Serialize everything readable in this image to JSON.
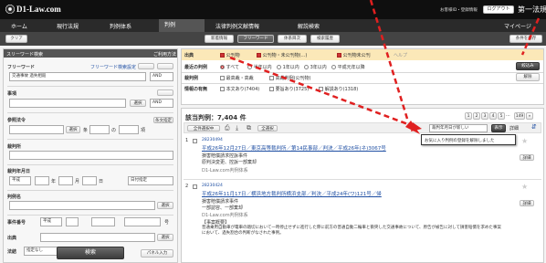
{
  "header": {
    "logo": "D1-Law.com",
    "logo_sub": "第一法規",
    "user_info": "お客様ID・登録情報",
    "logout": "ログアウト"
  },
  "nav": {
    "tabs": [
      "ホーム",
      "現行法規",
      "判例体系",
      "判例",
      "法律判例文献情報",
      "解説検索"
    ],
    "mypage": "マイページ"
  },
  "toolbar": {
    "clear": "クリア",
    "tabs": [
      "新着情報",
      "フリーワード",
      "体系目次",
      "検索履歴"
    ],
    "save": "条件を保存"
  },
  "search_panel": {
    "title": "スリーワード検索",
    "help": "ご利用方法",
    "freeword_label": "フリーワード",
    "freeword_link": "フリーワード検索設定",
    "freeword_value": "交通事故 過失相殺",
    "freeword_op": "AND",
    "jiken_label": "事項",
    "select_btn": "選択",
    "andor": "AND",
    "houki_label": "参照法令",
    "zenbun": "条文指定",
    "hou": "法",
    "jou": "条",
    "no": "の",
    "kou": "項",
    "court_label": "裁判所",
    "date_label": "裁判年月日",
    "date_unit": "日付指定",
    "year": "年",
    "month": "月",
    "day": "日",
    "era": "平成",
    "case_label": "事件番号",
    "wa": "ワ",
    "go": "号",
    "shutten_label": "出典",
    "hanrei_label": "判例名",
    "soutou_label": "法結",
    "soutou_val": "指定なし",
    "search_btn": "検索",
    "panel_btn": "パネル入力",
    "bottom_links": [
      "全角入力",
      "半角入力"
    ]
  },
  "filters": {
    "shutten": "出典",
    "sort_opts": [
      "公刊物",
      "公刊物・未公刊物(...)",
      "公刊物未公刊"
    ],
    "help": "ヘルプ",
    "saibansho": "最高裁判所",
    "year_label": "最近の判例",
    "year_opts": [
      "すべて",
      "半年以内",
      "1年以内",
      "3年以内",
      "平成元年以降"
    ],
    "kyu": "裁判例",
    "kyu_opts": [
      "最高裁・高裁",
      "高裁判例(公刊物)"
    ],
    "info_label": "情報の有無",
    "info_opts": [
      "本文あり(7404)",
      "要旨あり(3725)",
      "解説あり(1318)"
    ],
    "narrow": "絞込み",
    "reset": "解除"
  },
  "results": {
    "count_label": "該当判例：7,404 件",
    "pages": [
      "1",
      "2",
      "3",
      "4",
      "5",
      "...",
      "149"
    ],
    "next": "»",
    "select_all": "全件選択中",
    "btn_all": "全選択",
    "sort": "裁判年月日が新しい",
    "display": "表示",
    "detail": "詳細",
    "tooltip": "お気に入り判例の登録を解除しました",
    "items": [
      {
        "no": "1",
        "id": "28230494",
        "title": "平成26年12月27日／東京高等裁判所／第14民事部／判決／平成26年(ネ)3067号",
        "sub1": "損害賠償請求控訴事件",
        "sub2": "原判決変更、控訴一部棄却",
        "sub3": "D1-Law.com判例体系"
      },
      {
        "no": "2",
        "id": "28230424",
        "title": "平成26年11月17日／横浜地方裁判所横浜支部／判決／平成24年(ワ)121号／帰",
        "sub1": "損害賠償請求事件",
        "sub2": "一部認容、一部棄却",
        "sub3": "D1-Law.com判例体系",
        "snippet_label": "【事案概要】",
        "snippet": "普通乗用自動車が電車の踏切において一時停止せずに進行した際に前方の普通自動二輪車と衝突した交通事故について、原告が被告に対して損害賠償を求めた事案において、過失割合の判断がなされた事例。"
      }
    ],
    "side_btns": [
      "詳細",
      "詳細"
    ]
  }
}
